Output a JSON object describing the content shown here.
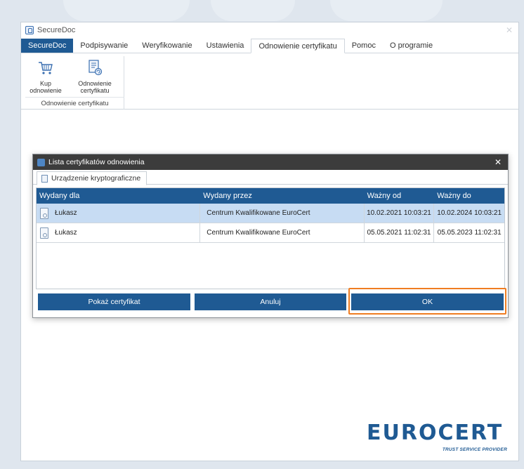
{
  "window": {
    "title": "SecureDoc"
  },
  "menu": {
    "tabs": [
      {
        "label": "SecureDoc"
      },
      {
        "label": "Podpisywanie"
      },
      {
        "label": "Weryfikowanie"
      },
      {
        "label": "Ustawienia"
      },
      {
        "label": "Odnowienie certyfikatu"
      },
      {
        "label": "Pomoc"
      },
      {
        "label": "O programie"
      }
    ]
  },
  "ribbon": {
    "buy_label_1": "Kup",
    "buy_label_2": "odnowienie",
    "renew_label_1": "Odnowienie",
    "renew_label_2": "certyfikatu",
    "group_label": "Odnowienie certyfikatu"
  },
  "dialog": {
    "title": "Lista certyfikatów odnowienia",
    "subtab": "Urządzenie kryptograficzne",
    "columns": [
      "Wydany dla",
      "Wydany przez",
      "Ważny od",
      "Ważny do"
    ],
    "rows": [
      {
        "issued_to": "Łukasz",
        "issued_by": "Centrum Kwalifikowane EuroCert",
        "valid_from": "10.02.2021 10:03:21",
        "valid_to": "10.02.2024 10:03:21",
        "selected": true
      },
      {
        "issued_to": "Łukasz",
        "issued_by": "Centrum Kwalifikowane EuroCert",
        "valid_from": "05.05.2021 11:02:31",
        "valid_to": "05.05.2023 11:02:31",
        "selected": false
      }
    ],
    "buttons": {
      "show_cert": "Pokaż certyfikat",
      "cancel": "Anuluj",
      "ok": "OK"
    }
  },
  "logo": {
    "text": "EUROCERT",
    "tagline": "TRUST SERVICE PROVIDER"
  },
  "colors": {
    "brand_blue": "#1f5a93",
    "highlight_orange": "#ef7d22",
    "selected_row": "#c7dcf3"
  }
}
